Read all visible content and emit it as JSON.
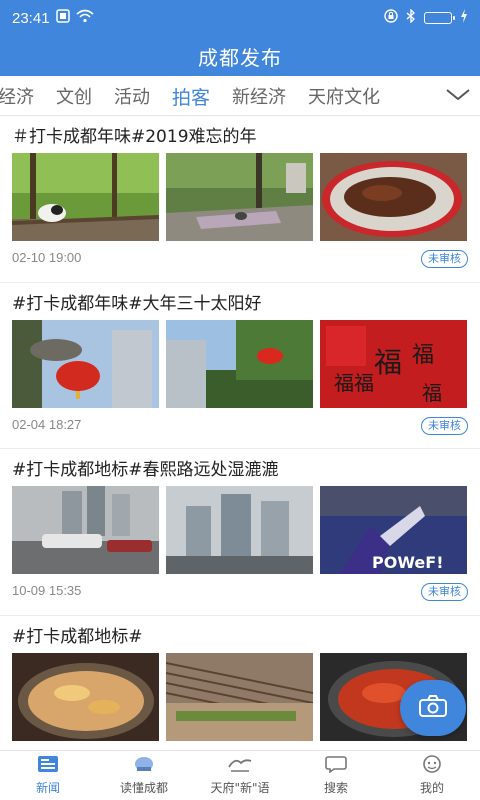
{
  "status_bar": {
    "time": "23:41"
  },
  "app": {
    "title": "成都发布"
  },
  "tabs": [
    {
      "label": "经济",
      "active": false
    },
    {
      "label": "文创",
      "active": false
    },
    {
      "label": "活动",
      "active": false
    },
    {
      "label": "拍客",
      "active": true
    },
    {
      "label": "新经济",
      "active": false
    },
    {
      "label": "天府文化",
      "active": false
    }
  ],
  "posts": [
    {
      "title": "＃打卡成都年味#2019难忘的年",
      "date": "02-10 19:00",
      "badge": "未审核"
    },
    {
      "title": "#打卡成都年味#大年三十太阳好",
      "date": "02-04 18:27",
      "badge": "未审核"
    },
    {
      "title": "#打卡成都地标#春熙路远处湿漉漉",
      "date": "10-09 15:35",
      "badge": "未审核"
    },
    {
      "title": "#打卡成都地标#",
      "date": "",
      "badge": ""
    }
  ],
  "photo_text": {
    "fu": "福",
    "fu_xiang": "福福",
    "power": "POWeF!"
  },
  "bottom_nav": [
    {
      "label": "新闻",
      "icon": "news-icon",
      "active": true
    },
    {
      "label": "读懂成都",
      "icon": "chengdu-icon",
      "active": false
    },
    {
      "label": "天府\"新\"语",
      "icon": "tianfu-icon",
      "active": false
    },
    {
      "label": "搜索",
      "icon": "search-icon",
      "active": false
    },
    {
      "label": "我的",
      "icon": "profile-icon",
      "active": false
    }
  ],
  "colors": {
    "brand": "#3f86dc",
    "text": "#222222",
    "muted": "#888888"
  }
}
